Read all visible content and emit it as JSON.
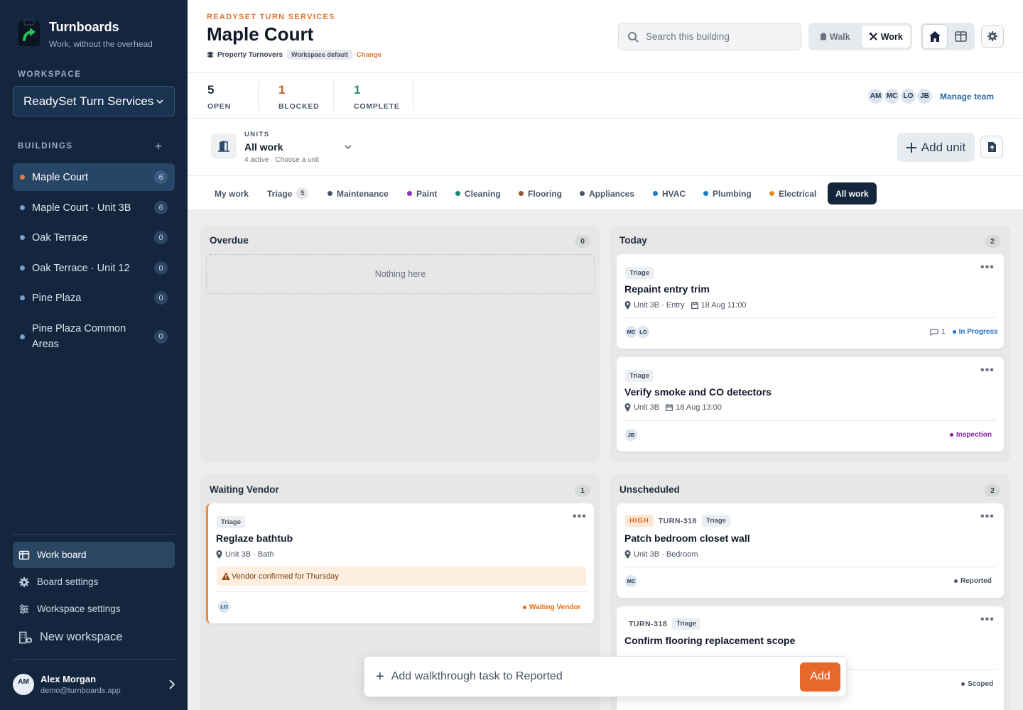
{
  "brand": {
    "name": "Turnboards",
    "tagline": "Work, without the overhead"
  },
  "sidebar": {
    "workspace_label": "WORKSPACE",
    "workspace_value": "ReadySet Turn Services",
    "buildings_label": "BUILDINGS",
    "buildings": [
      {
        "name": "Maple Court",
        "count": "6",
        "active": true
      },
      {
        "name": "Maple Court · Unit 3B",
        "count": "6"
      },
      {
        "name": "Oak Terrace",
        "count": "0"
      },
      {
        "name": "Oak Terrace · Unit 12",
        "count": "0"
      },
      {
        "name": "Pine Plaza",
        "count": "0"
      },
      {
        "name": "Pine Plaza Common Areas",
        "count": "0"
      }
    ],
    "nav": [
      {
        "label": "Work board",
        "icon": "board-icon",
        "active": true
      },
      {
        "label": "Board settings",
        "icon": "gear-icon"
      },
      {
        "label": "Workspace settings",
        "icon": "sliders-icon"
      },
      {
        "label": "New workspace",
        "icon": "new-building-icon"
      }
    ],
    "user": {
      "initials": "AM",
      "name": "Alex Morgan",
      "email": "demo@turnboards.app"
    }
  },
  "header": {
    "org": "READYSET TURN SERVICES",
    "title": "Maple Court",
    "template": "Property Turnovers",
    "template_pill": "Workspace default",
    "change": "Change",
    "search_placeholder": "Search this building",
    "modes": [
      "Walk",
      "Work"
    ],
    "active_mode": "Work"
  },
  "stats": [
    {
      "value": "5",
      "label": "OPEN",
      "color": "#1f2937"
    },
    {
      "value": "1",
      "label": "BLOCKED",
      "color": "#c2622a"
    },
    {
      "value": "1",
      "label": "COMPLETE",
      "color": "#22876a"
    }
  ],
  "team": {
    "members": [
      "AM",
      "MC",
      "LO",
      "JB"
    ],
    "manage": "Manage team"
  },
  "units": {
    "kicker": "UNITS",
    "value": "All work",
    "sub": "4 active · Choose a unit",
    "add": "Add unit"
  },
  "filters": [
    {
      "label": "My work"
    },
    {
      "label": "Triage",
      "badge": "5"
    },
    {
      "label": "Maintenance",
      "dot": "#4b5563"
    },
    {
      "label": "Paint",
      "dot": "#8b2fc9"
    },
    {
      "label": "Cleaning",
      "dot": "#16866f"
    },
    {
      "label": "Flooring",
      "dot": "#8a5a3c"
    },
    {
      "label": "Appliances",
      "dot": "#4b5563"
    },
    {
      "label": "HVAC",
      "dot": "#1f7ac4"
    },
    {
      "label": "Plumbing",
      "dot": "#1f7ac4"
    },
    {
      "label": "Electrical",
      "dot": "#e88a1a"
    },
    {
      "label": "All work",
      "active": true
    }
  ],
  "columns": {
    "overdue": {
      "title": "Overdue",
      "count": "0",
      "empty": "Nothing here"
    },
    "today": {
      "title": "Today",
      "count": "2"
    },
    "waiting": {
      "title": "Waiting Vendor",
      "count": "1"
    },
    "unscheduled": {
      "title": "Unscheduled",
      "count": "2"
    }
  },
  "cards": {
    "c1": {
      "tag": "Triage",
      "title": "Repaint entry trim",
      "location": "Unit 3B · Entry",
      "date": "18 Aug 11:00",
      "assignees": [
        "MC",
        "LO"
      ],
      "comments": "1",
      "status": "In Progress",
      "status_color": "#1f6fc4"
    },
    "c2": {
      "tag": "Triage",
      "title": "Verify smoke and CO detectors",
      "location": "Unit 3B",
      "date": "18 Aug 13:00",
      "assignees": [
        "JB"
      ],
      "status": "Inspection",
      "status_color": "#8b1fa0"
    },
    "c3": {
      "tag": "Triage",
      "title": "Reglaze bathtub",
      "location": "Unit 3B · Bath",
      "note": "Vendor confirmed for Thursday",
      "assignees": [
        "LO"
      ],
      "status": "Waiting Vendor",
      "status_color": "#e06d10"
    },
    "c4": {
      "priority": "HIGH",
      "ref": "TURN-318",
      "tag": "Triage",
      "title": "Patch bedroom closet wall",
      "location": "Unit 3B · Bedroom",
      "assignees": [
        "MC"
      ],
      "status": "Reported",
      "status_color": "#4b5563"
    },
    "c5": {
      "ref": "TURN-318",
      "tag": "Triage",
      "title": "Confirm flooring replacement scope",
      "status": "Scoped",
      "status_color": "#4b5563"
    }
  },
  "quick_add": {
    "placeholder": "Add walkthrough task to Reported",
    "button": "Add"
  }
}
